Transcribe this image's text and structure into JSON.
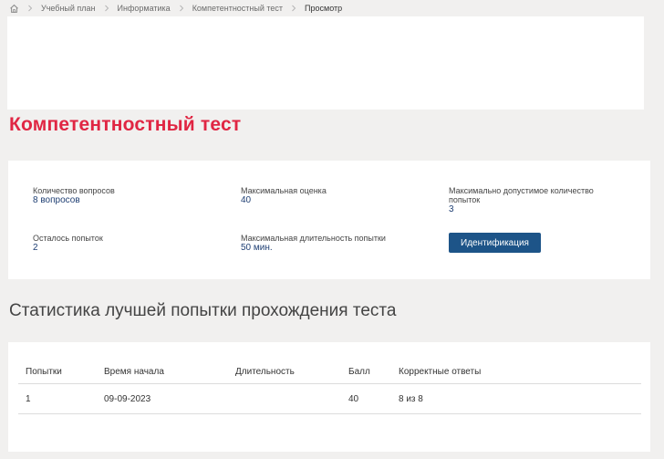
{
  "breadcrumb": {
    "items": [
      "Учебный план",
      "Информатика",
      "Компетентностный тест",
      "Просмотр"
    ]
  },
  "page": {
    "title": "Компетентностный тест"
  },
  "info": {
    "questions": {
      "label": "Количество вопросов",
      "value": "8 вопросов"
    },
    "max_grade": {
      "label": "Максимальная оценка",
      "value": "40"
    },
    "max_attempts": {
      "label": "Максимально допустимое количество попыток",
      "value": "3"
    },
    "attempts_left": {
      "label": "Осталось попыток",
      "value": "2"
    },
    "max_duration": {
      "label": "Максимальная длительность попытки",
      "value": "50 мин."
    },
    "identify_button": "Идентификация"
  },
  "stats": {
    "title": "Статистика лучшей попытки прохождения теста",
    "columns": [
      "Попытки",
      "Время начала",
      "Длительность",
      "Балл",
      "Корректные ответы"
    ],
    "rows": [
      [
        "1",
        "09-09-2023",
        "",
        "40",
        "8 из 8"
      ]
    ]
  },
  "colors": {
    "accent_title": "#e02643",
    "button": "#1d5488",
    "value_text": "#1f3f73",
    "background": "#f1f0ef"
  }
}
